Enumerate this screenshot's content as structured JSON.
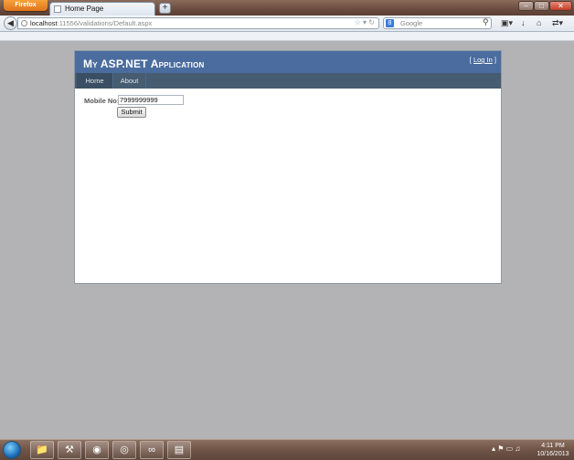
{
  "browser": {
    "menu_button": "Firefox",
    "tab_title": "Home Page",
    "new_tab": "+",
    "url_host": "localhost",
    "url_rest": ":11556/validations/Default.aspx",
    "search_engine": "8",
    "search_placeholder": "Google"
  },
  "site": {
    "title": "My ASP.NET Application",
    "login_prefix": "[ ",
    "login_link": "Log In",
    "login_suffix": " ]",
    "menu": [
      {
        "label": "Home"
      },
      {
        "label": "About"
      }
    ],
    "form": {
      "mobile_label": "Mobile No:",
      "mobile_value": "7999999999",
      "submit_label": "Submit"
    }
  },
  "taskbar": {
    "time": "4:11 PM",
    "date": "10/16/2013"
  }
}
